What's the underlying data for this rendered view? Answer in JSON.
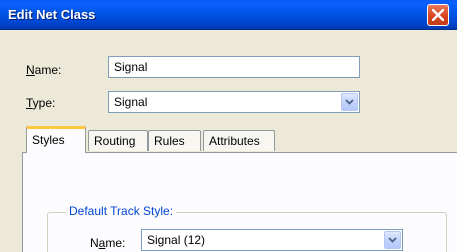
{
  "window": {
    "title": "Edit Net Class"
  },
  "fields": {
    "name_label": "Name:",
    "name_value": "Signal",
    "type_label": "Type:",
    "type_value": "Signal"
  },
  "tabs": [
    {
      "label": "Styles"
    },
    {
      "label": "Routing"
    },
    {
      "label": "Rules"
    },
    {
      "label": "Attributes"
    }
  ],
  "styles_tab": {
    "group_title": "Default Track Style:",
    "name_label": "Name:",
    "name_value": "Signal (12)"
  },
  "icons": {
    "close": "close-icon",
    "dropdown": "chevron-down-icon"
  }
}
